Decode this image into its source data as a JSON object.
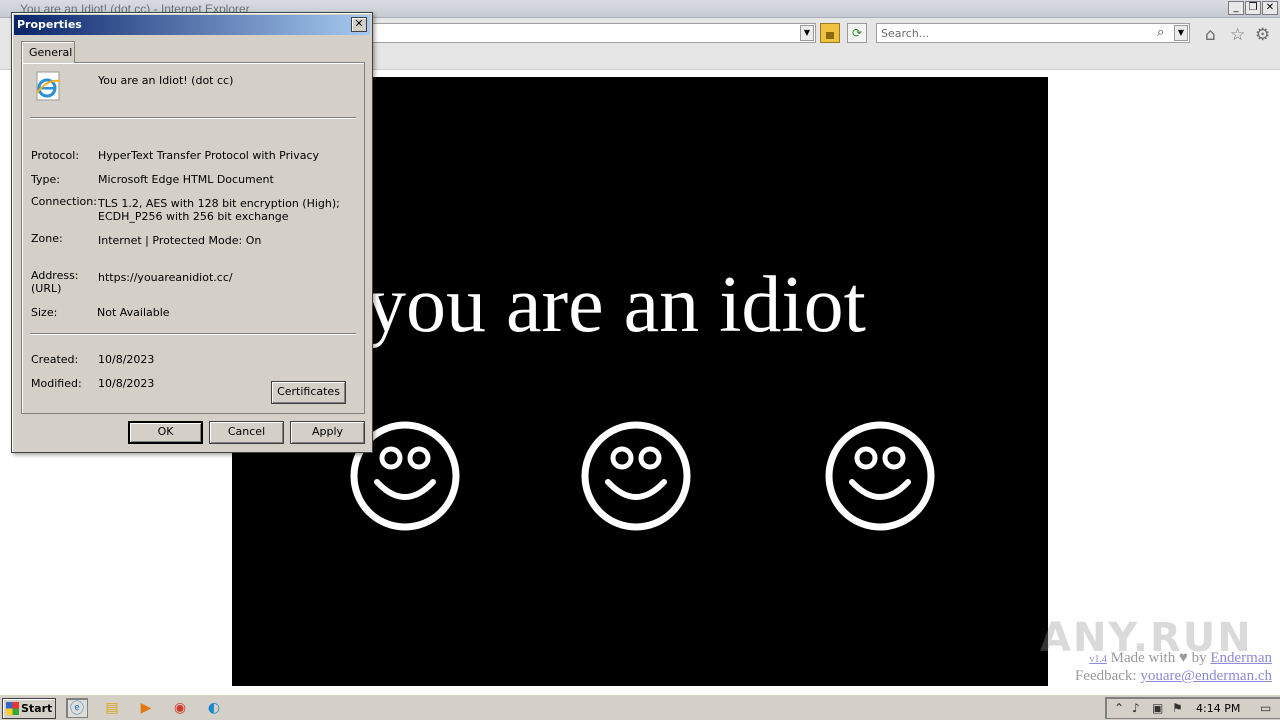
{
  "browser": {
    "window_title": "You are an Idiot! (dot cc) - Internet Explorer",
    "search_placeholder": "Search...",
    "controls": {
      "minimize": "_",
      "restore": "❐",
      "close": "✕"
    }
  },
  "page": {
    "headline": "you are an idiot",
    "made_with": "Made with",
    "heart": "♥",
    "by": "by",
    "author": "Enderman",
    "version": "v1.4",
    "feedback_label": "Feedback:",
    "feedback_email": "youare@enderman.ch",
    "watermark": "ANY.RUN",
    "smiley_count": 3
  },
  "dialog": {
    "title": "Properties",
    "close": "✕",
    "tab": "General",
    "file_name": "You are an Idiot! (dot cc)",
    "protocol_label": "Protocol:",
    "protocol_value": "HyperText Transfer Protocol with Privacy",
    "type_label": "Type:",
    "type_value": "Microsoft Edge HTML Document",
    "connection_label": "Connection:",
    "connection_value_1": "TLS 1.2, AES with 128 bit encryption (High);",
    "connection_value_2": "ECDH_P256 with 256 bit exchange",
    "zone_label": "Zone:",
    "zone_value": "Internet | Protected Mode: On",
    "address_label_1": "Address:",
    "address_label_2": "(URL)",
    "address_value": "https://youareanidiot.cc/",
    "size_label": "Size:",
    "size_value": "Not Available",
    "created_label": "Created:",
    "created_value": "10/8/2023",
    "modified_label": "Modified:",
    "modified_value": "10/8/2023",
    "certificates_button": "Certificates",
    "ok_button": "OK",
    "cancel_button": "Cancel",
    "apply_button": "Apply"
  },
  "taskbar": {
    "start_label": "Start",
    "clock": "4:14 PM"
  },
  "colors": {
    "dialog_bg": "#d4d0c8",
    "title_gradient_start": "#0a246a",
    "page_bg": "#000000",
    "headline": "#ffffff"
  }
}
